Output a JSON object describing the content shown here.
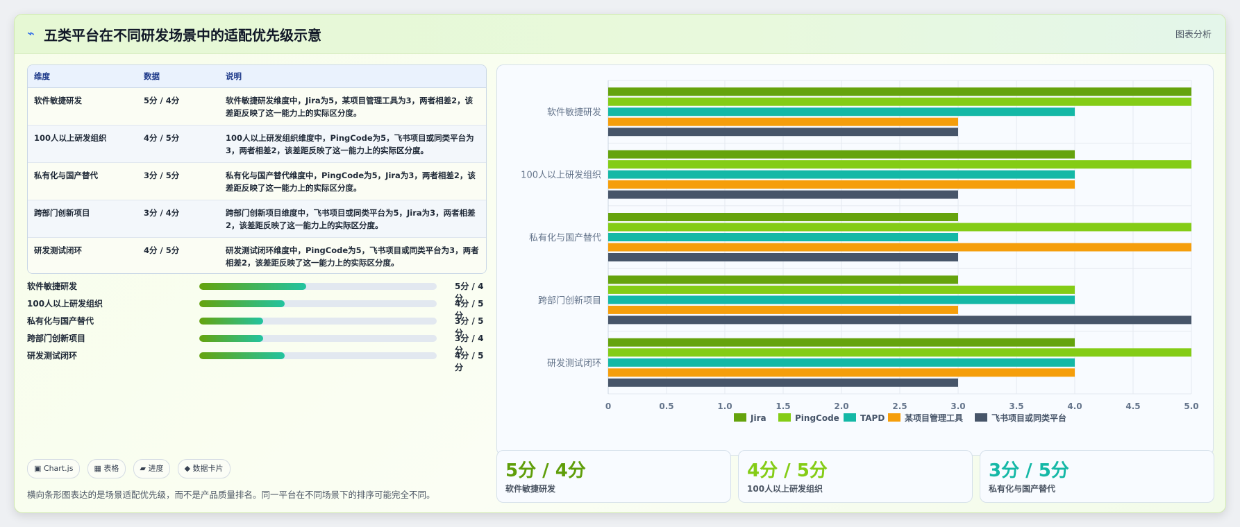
{
  "header": {
    "icon": "lightning-bolt-icon",
    "title": "五类平台在不同研发场景中的适配优先级示意",
    "tag": "图表分析"
  },
  "table": {
    "headers": [
      "维度",
      "数据",
      "说明"
    ],
    "rows": [
      {
        "dim": "软件敏捷研发",
        "data": "5分 / 4分",
        "desc": "软件敏捷研发维度中，Jira为5，某项目管理工具为3，两者相差2，该差距反映了这一能力上的实际区分度。"
      },
      {
        "dim": "100人以上研发组织",
        "data": "4分 / 5分",
        "desc": "100人以上研发组织维度中，PingCode为5，飞书项目或同类平台为3，两者相差2，该差距反映了这一能力上的实际区分度。"
      },
      {
        "dim": "私有化与国产替代",
        "data": "3分 / 5分",
        "desc": "私有化与国产替代维度中，PingCode为5，Jira为3，两者相差2，该差距反映了这一能力上的实际区分度。"
      },
      {
        "dim": "跨部门创新项目",
        "data": "3分 / 4分",
        "desc": "跨部门创新项目维度中，飞书项目或同类平台为5，Jira为3，两者相差2，该差距反映了这一能力上的实际区分度。"
      },
      {
        "dim": "研发测试闭环",
        "data": "4分 / 5分",
        "desc": "研发测试闭环维度中，PingCode为5，飞书项目或同类平台为3，两者相差2，该差距反映了这一能力上的实际区分度。"
      }
    ]
  },
  "progress": [
    {
      "label": "软件敏捷研发",
      "value": "5分 / 4分",
      "fraction": 0.45
    },
    {
      "label": "100人以上研发组织",
      "value": "4分 / 5分",
      "fraction": 0.36
    },
    {
      "label": "私有化与国产替代",
      "value": "3分 / 5分",
      "fraction": 0.27
    },
    {
      "label": "跨部门创新项目",
      "value": "3分 / 4分",
      "fraction": 0.27
    },
    {
      "label": "研发测试闭环",
      "value": "4分 / 5分",
      "fraction": 0.36
    }
  ],
  "chips": [
    {
      "icon": "chart-icon",
      "glyph": "▣",
      "label": "Chart.js"
    },
    {
      "icon": "table-icon",
      "glyph": "▦",
      "label": "表格"
    },
    {
      "icon": "progress-icon",
      "glyph": "▰",
      "label": "进度"
    },
    {
      "icon": "diamond-icon",
      "glyph": "◆",
      "label": "数据卡片"
    }
  ],
  "footnote": "横向条形图表达的是场景适配优先级，而不是产品质量排名。同一平台在不同场景下的排序可能完全不同。",
  "kpis": [
    {
      "value": "5分 / 4分",
      "label": "软件敏捷研发",
      "color": "#5f9e0a"
    },
    {
      "value": "4分 / 5分",
      "label": "100人以上研发组织",
      "color": "#84cc16"
    },
    {
      "value": "3分 / 5分",
      "label": "私有化与国产替代",
      "color": "#14b8a6"
    }
  ],
  "chart_data": {
    "type": "bar",
    "orientation": "horizontal",
    "categories": [
      "软件敏捷研发",
      "100人以上研发组织",
      "私有化与国产替代",
      "跨部门创新项目",
      "研发测试闭环"
    ],
    "series": [
      {
        "name": "Jira",
        "color": "#65a30d",
        "values": [
          5,
          4,
          3,
          3,
          4
        ]
      },
      {
        "name": "PingCode",
        "color": "#84cc16",
        "values": [
          5,
          5,
          5,
          4,
          5
        ]
      },
      {
        "name": "TAPD",
        "color": "#14b8a6",
        "values": [
          4,
          4,
          3,
          4,
          4
        ]
      },
      {
        "name": "某项目管理工具",
        "color": "#f59e0b",
        "values": [
          3,
          4,
          5,
          3,
          4
        ]
      },
      {
        "name": "飞书项目或同类平台",
        "color": "#475569",
        "values": [
          3,
          3,
          3,
          5,
          3
        ]
      }
    ],
    "xlim": [
      0,
      5
    ],
    "xticks": [
      "0",
      "0.5",
      "1.0",
      "1.5",
      "2.0",
      "2.5",
      "3.0",
      "3.5",
      "4.0",
      "4.5",
      "5.0"
    ],
    "grid": true,
    "legend_position": "bottom"
  }
}
